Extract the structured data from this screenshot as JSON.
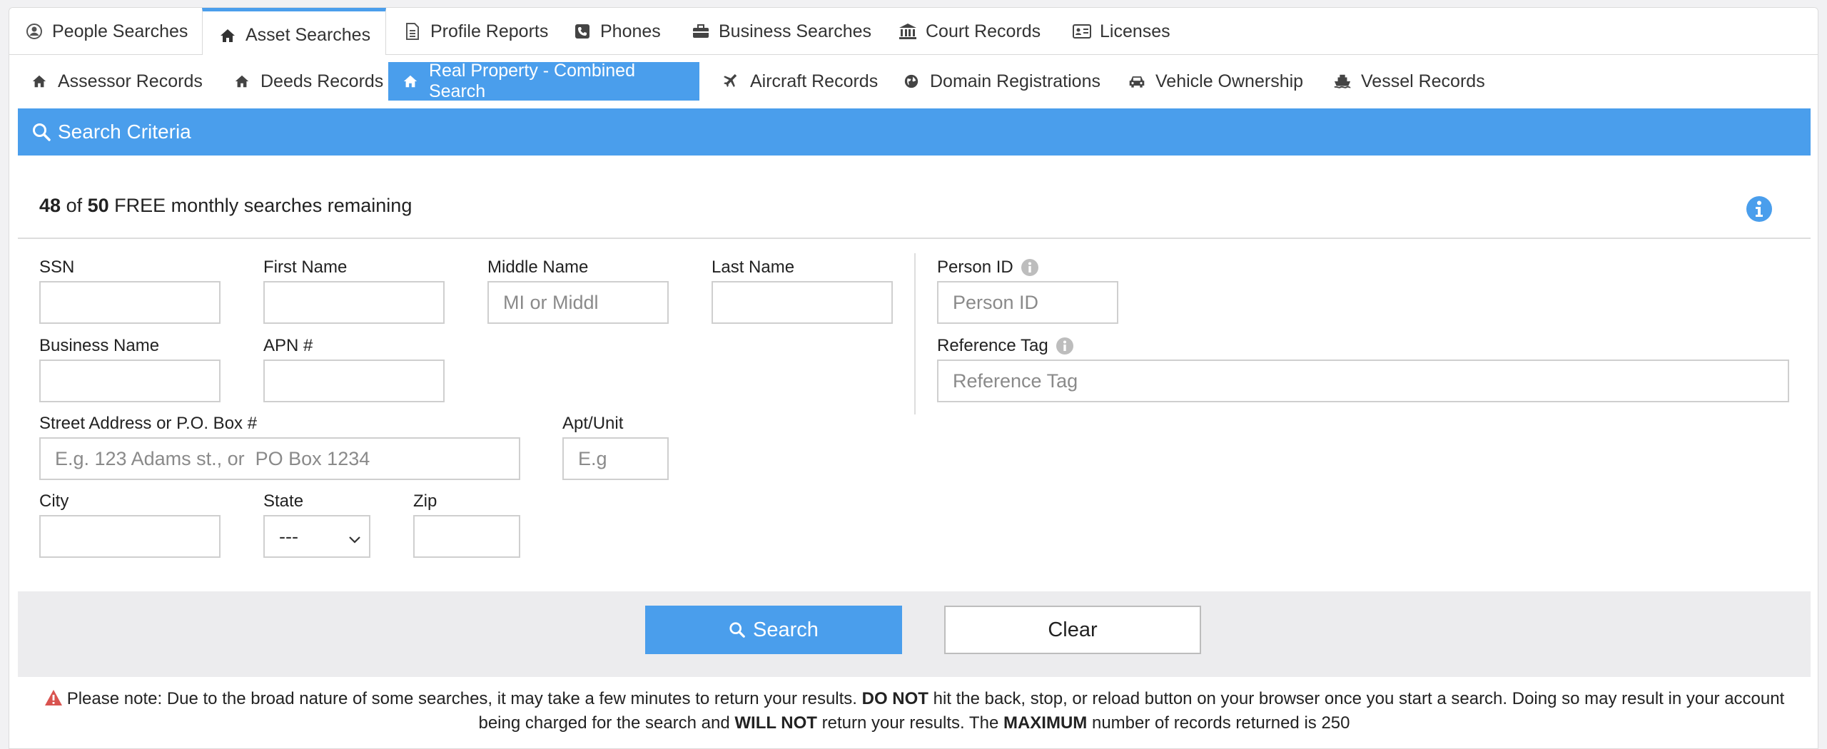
{
  "top_tabs": [
    {
      "label": "People Searches",
      "icon": "person-circle-icon"
    },
    {
      "label": "Asset Searches",
      "icon": "home-icon"
    },
    {
      "label": "Profile Reports",
      "icon": "document-icon"
    },
    {
      "label": "Phones",
      "icon": "phone-icon"
    },
    {
      "label": "Business Searches",
      "icon": "briefcase-icon"
    },
    {
      "label": "Court Records",
      "icon": "courthouse-icon"
    },
    {
      "label": "Licenses",
      "icon": "id-card-icon"
    }
  ],
  "active_top_tab": "Asset Searches",
  "sub_tabs": [
    {
      "label": "Assessor Records",
      "icon": "home-icon"
    },
    {
      "label": "Deeds Records",
      "icon": "home-icon"
    },
    {
      "label": "Real Property - Combined Search",
      "icon": "home-icon"
    },
    {
      "label": "Aircraft Records",
      "icon": "plane-icon"
    },
    {
      "label": "Domain Registrations",
      "icon": "globe-icon"
    },
    {
      "label": "Vehicle Ownership",
      "icon": "car-icon"
    },
    {
      "label": "Vessel Records",
      "icon": "ship-icon"
    }
  ],
  "active_sub_tab": "Real Property - Combined Search",
  "criteria": {
    "title": "Search Criteria"
  },
  "quota": {
    "used": "48",
    "of": "of",
    "total": "50",
    "text": "FREE monthly searches remaining"
  },
  "form": {
    "ssn": {
      "label": "SSN",
      "value": "",
      "placeholder": ""
    },
    "first_name": {
      "label": "First Name",
      "value": "",
      "placeholder": ""
    },
    "middle_name": {
      "label": "Middle Name",
      "value": "",
      "placeholder": "MI or Middl"
    },
    "last_name": {
      "label": "Last Name",
      "value": "",
      "placeholder": ""
    },
    "person_id": {
      "label": "Person ID",
      "value": "",
      "placeholder": "Person ID"
    },
    "business_name": {
      "label": "Business Name",
      "value": "",
      "placeholder": ""
    },
    "apn": {
      "label": "APN #",
      "value": "",
      "placeholder": ""
    },
    "reference_tag": {
      "label": "Reference Tag",
      "value": "",
      "placeholder": "Reference Tag"
    },
    "street": {
      "label": "Street Address or P.O. Box #",
      "value": "",
      "placeholder": "E.g. 123 Adams st., or  PO Box 1234"
    },
    "apt": {
      "label": "Apt/Unit",
      "value": "",
      "placeholder": "E.g"
    },
    "city": {
      "label": "City",
      "value": "",
      "placeholder": ""
    },
    "state": {
      "label": "State",
      "selected": "---"
    },
    "zip": {
      "label": "Zip",
      "value": "",
      "placeholder": ""
    }
  },
  "buttons": {
    "search": "Search",
    "clear": "Clear"
  },
  "note": {
    "part1": "Please note: Due to the broad nature of some searches, it may take a few minutes to return your results.",
    "bold1": "DO NOT",
    "part2": "hit the back, stop, or reload button on your browser once you start a search. Doing so may result in your account being charged for the search and",
    "bold2": "WILL NOT",
    "part3": "return your results. The",
    "bold3": "MAXIMUM",
    "part4": "number of records returned is 250"
  },
  "colors": {
    "accent": "#4a9eec",
    "warning": "#d9534f"
  }
}
